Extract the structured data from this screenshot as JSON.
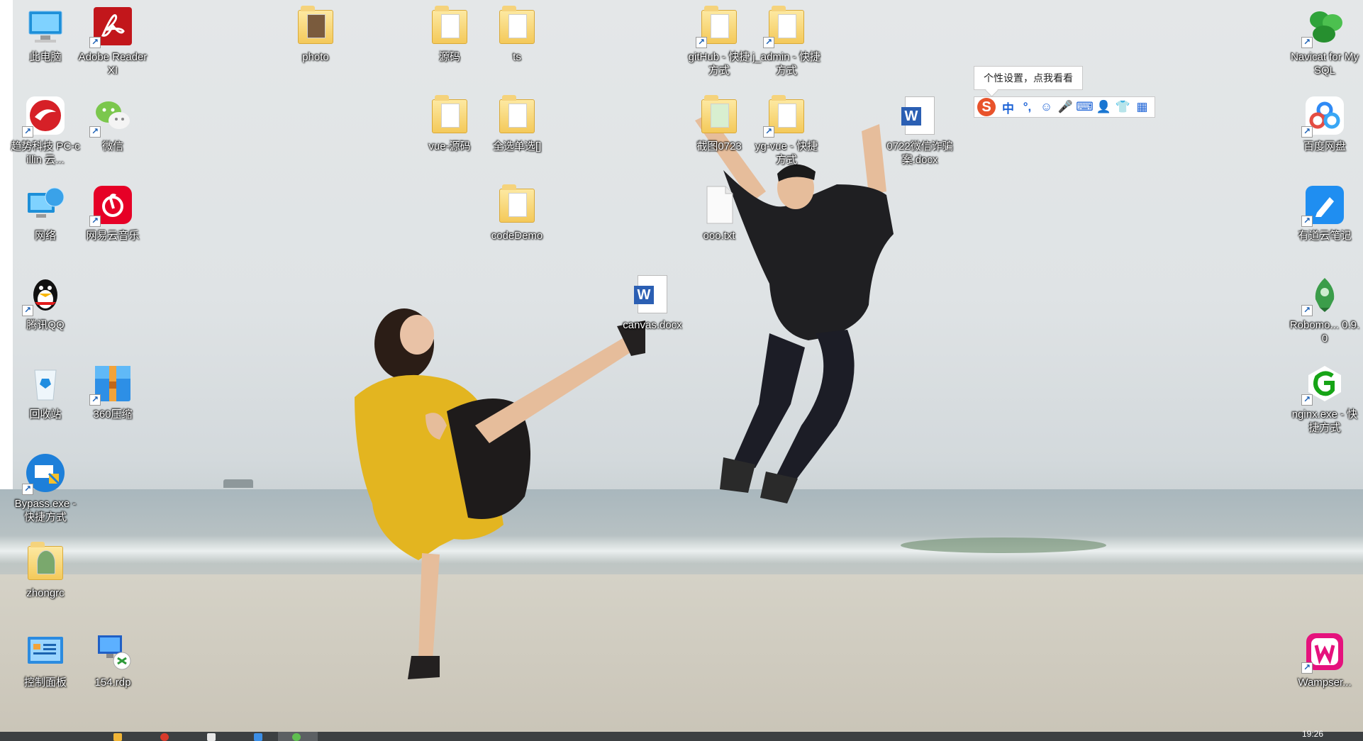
{
  "desktop": {
    "icons": [
      {
        "name": "this-pc-icon",
        "label": "此电脑"
      },
      {
        "name": "adobe-reader-icon",
        "label": "Adobe Reader XI"
      },
      {
        "name": "photo-folder-icon",
        "label": "photo"
      },
      {
        "name": "source-folder-icon",
        "label": "源码"
      },
      {
        "name": "ts-folder-icon",
        "label": "ts"
      },
      {
        "name": "github-shortcut-icon",
        "label": "gitHub - 快捷方式"
      },
      {
        "name": "j-admin-shortcut-icon",
        "label": "j_admin - 快捷方式"
      },
      {
        "name": "navicat-icon",
        "label": "Navicat for MySQL"
      },
      {
        "name": "trend-micro-icon",
        "label": "趋势科技 PC-cillin 云..."
      },
      {
        "name": "wechat-icon",
        "label": "微信"
      },
      {
        "name": "vue-source-folder-icon",
        "label": "vue-源码"
      },
      {
        "name": "select-all-folder-icon",
        "label": "全选单选[]"
      },
      {
        "name": "screenshot-folder-icon",
        "label": "截图0723"
      },
      {
        "name": "yg-vue-shortcut-icon",
        "label": "yg-vue - 快捷方式"
      },
      {
        "name": "word-doc-0722-icon",
        "label": "0722微信诈骗案.docx"
      },
      {
        "name": "baidu-netdisk-icon",
        "label": "百度网盘"
      },
      {
        "name": "network-icon",
        "label": "网络"
      },
      {
        "name": "netease-music-icon",
        "label": "网易云音乐"
      },
      {
        "name": "codedemo-folder-icon",
        "label": "codeDemo"
      },
      {
        "name": "ooo-txt-icon",
        "label": "ooo.txt"
      },
      {
        "name": "youdao-note-icon",
        "label": "有道云笔记"
      },
      {
        "name": "qq-icon",
        "label": "腾讯QQ"
      },
      {
        "name": "canvas-docx-icon",
        "label": "canvas.docx"
      },
      {
        "name": "robomongo-icon",
        "label": "Robomo... 0.9.0"
      },
      {
        "name": "recycle-bin-icon",
        "label": "回收站"
      },
      {
        "name": "zip-360-icon",
        "label": "360压缩"
      },
      {
        "name": "nginx-shortcut-icon",
        "label": "nginx.exe - 快捷方式"
      },
      {
        "name": "bypass-shortcut-icon",
        "label": "Bypass.exe - 快捷方式"
      },
      {
        "name": "zhongrc-folder-icon",
        "label": "zhongrc"
      },
      {
        "name": "control-panel-icon",
        "label": "控制面板"
      },
      {
        "name": "rdp-154-icon",
        "label": "154.rdp"
      },
      {
        "name": "wampserver-icon",
        "label": "Wampser..."
      }
    ]
  },
  "ime": {
    "tooltip": "个性设置，点我看看",
    "logo": "S",
    "buttons": [
      "中",
      "°,",
      "☺",
      "🎤",
      "⌨",
      "👤",
      "👕",
      "▦"
    ]
  },
  "taskbar": {
    "clock": "19:26"
  },
  "colors": {
    "wallpaper_sky": "#e1e5e6",
    "taskbar": "#3c4042",
    "ime_blue": "#1d63d6",
    "ime_logo": "#e8532b"
  }
}
